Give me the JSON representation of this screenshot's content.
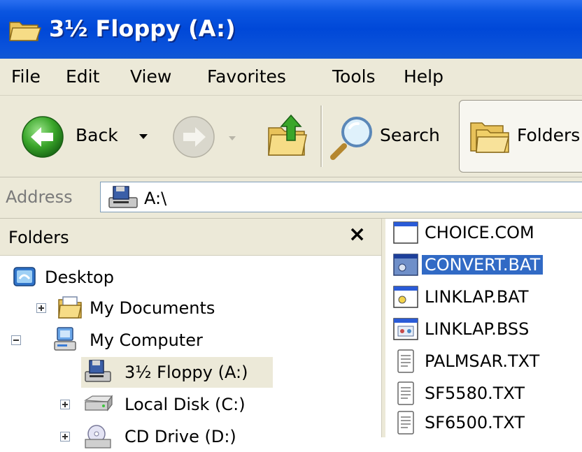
{
  "window": {
    "title": "3½ Floppy (A:)"
  },
  "menu": {
    "items": [
      "File",
      "Edit",
      "View",
      "Favorites",
      "Tools",
      "Help"
    ]
  },
  "toolbar": {
    "back_label": "Back",
    "search_label": "Search",
    "folders_label": "Folders"
  },
  "address": {
    "label": "Address",
    "value": "A:\\"
  },
  "folders_pane": {
    "title": "Folders",
    "close_symbol": "×",
    "tree": [
      {
        "label": "Desktop",
        "icon": "desktop-icon"
      },
      {
        "label": "My Documents",
        "icon": "my-documents-icon",
        "expander": "plus"
      },
      {
        "label": "My Computer",
        "icon": "my-computer-icon",
        "expander": "minus"
      },
      {
        "label": "3½ Floppy (A:)",
        "icon": "floppy-drive-icon",
        "selected": true
      },
      {
        "label": "Local Disk (C:)",
        "icon": "hard-disk-icon",
        "expander": "plus"
      },
      {
        "label": "CD Drive (D:)",
        "icon": "cd-drive-icon",
        "expander": "plus"
      }
    ]
  },
  "files": [
    {
      "name": "CHOICE.COM",
      "icon": "program-icon"
    },
    {
      "name": "CONVERT.BAT",
      "icon": "batch-file-icon",
      "selected": true
    },
    {
      "name": "LINKLAP.BAT",
      "icon": "batch-file-icon"
    },
    {
      "name": "LINKLAP.BSS",
      "icon": "settings-file-icon"
    },
    {
      "name": "PALMSAR.TXT",
      "icon": "text-file-icon"
    },
    {
      "name": "SF5580.TXT",
      "icon": "text-file-icon"
    },
    {
      "name": "SF6500.TXT",
      "icon": "text-file-icon"
    }
  ],
  "colors": {
    "title_bar": "#0048d8",
    "chrome": "#ece9d8",
    "selection": "#316ac5"
  }
}
